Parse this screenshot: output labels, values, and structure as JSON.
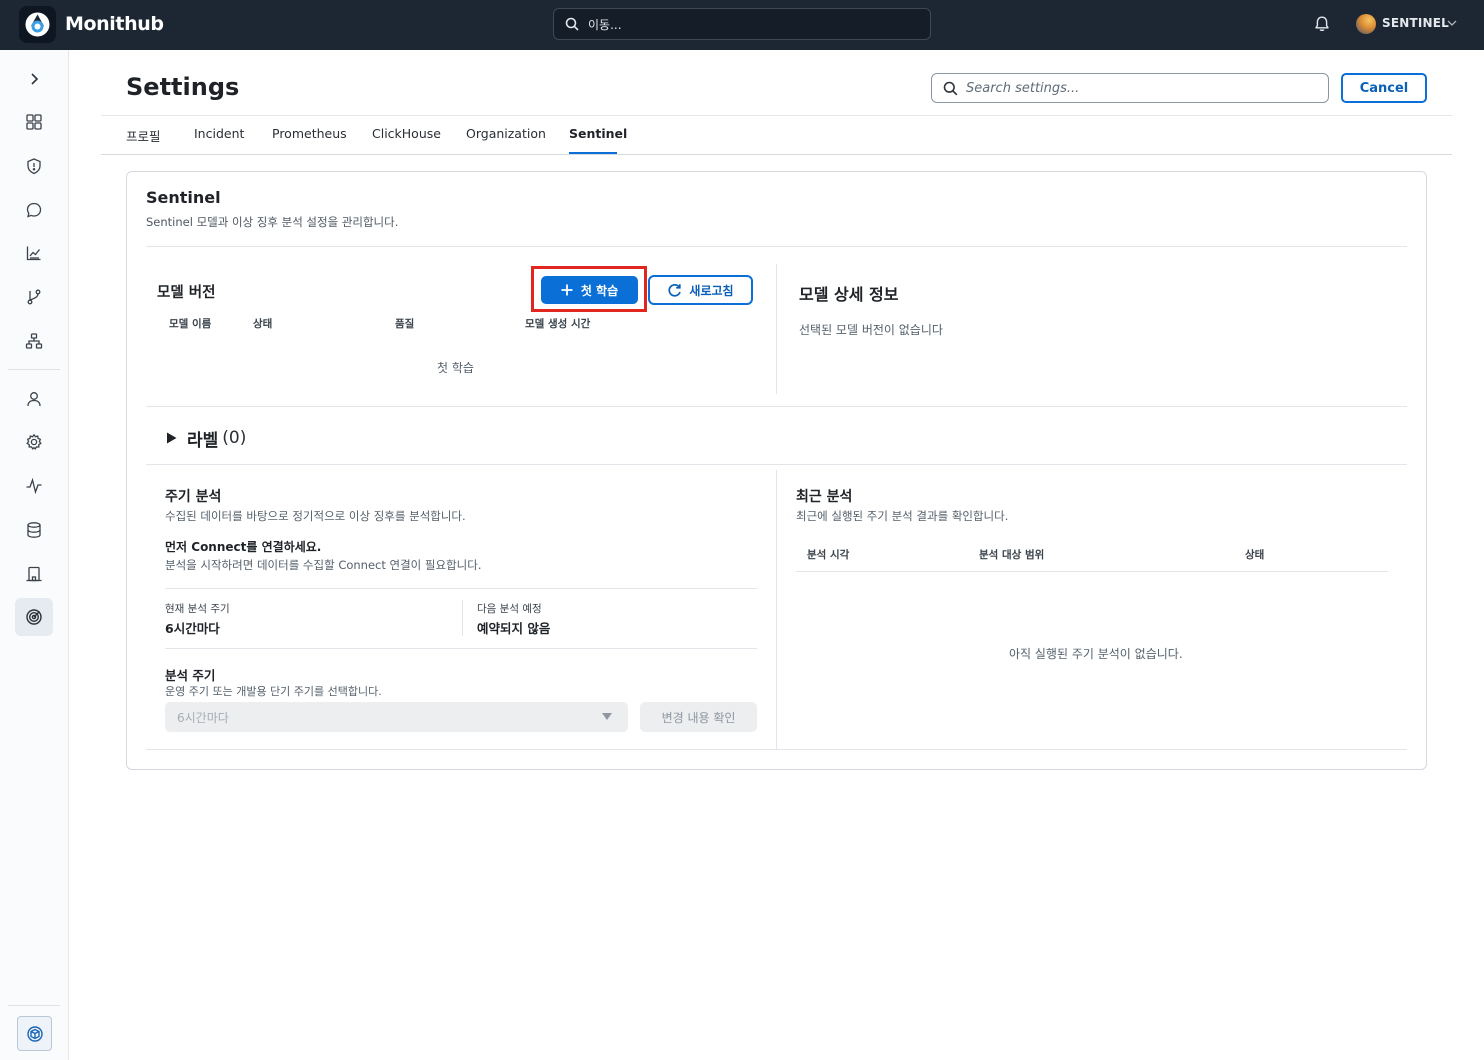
{
  "app": {
    "name": "Monithub"
  },
  "topbar": {
    "search_value": "이동...",
    "user_name": "SENTINEL"
  },
  "sidebar": {
    "items": [
      "chevron-right-icon",
      "dashboard-icon",
      "shield-icon",
      "chat-icon",
      "chart-icon",
      "git-branch-icon",
      "network-icon",
      "user-icon",
      "gear-icon",
      "activity-icon",
      "database-icon",
      "building-icon",
      "radar-icon"
    ],
    "active_item": "radar-icon",
    "bottom_item": "package-icon"
  },
  "header": {
    "title": "Settings",
    "search_placeholder": "Search settings...",
    "cancel_label": "Cancel"
  },
  "tabs": [
    {
      "label": "프로필",
      "active": false
    },
    {
      "label": "Incident",
      "active": false
    },
    {
      "label": "Prometheus",
      "active": false
    },
    {
      "label": "ClickHouse",
      "active": false
    },
    {
      "label": "Organization",
      "active": false
    },
    {
      "label": "Sentinel",
      "active": true
    }
  ],
  "section": {
    "title": "Sentinel",
    "description": "Sentinel 모델과 이상 징후 분석 설정을 관리합니다."
  },
  "model_versions": {
    "title": "모델 버전",
    "first_train_button": "첫 학습",
    "refresh_button": "새로고침",
    "columns": [
      "모델 이름",
      "상태",
      "품질",
      "모델 생성 시간"
    ],
    "empty_text": "첫 학습"
  },
  "model_detail": {
    "title": "모델 상세 정보",
    "empty_text": "선택된 모델 버전이 없습니다"
  },
  "labels": {
    "title": "라벨",
    "count": "(0)"
  },
  "periodic": {
    "title": "주기 분석",
    "description": "수집된 데이터를 바탕으로 정기적으로 이상 징후를 분석합니다.",
    "notice_title": "먼저 Connect를 연결하세요.",
    "notice_desc": "분석을 시작하려면 데이터를 수집할 Connect 연결이 필요합니다.",
    "current_label": "현재 분석 주기",
    "current_value": "6시간마다",
    "next_label": "다음 분석 예정",
    "next_value": "예약되지 않음",
    "interval_title": "분석 주기",
    "interval_desc": "운영 주기 또는 개발용 단기 주기를 선택합니다.",
    "select_value": "6시간마다",
    "confirm_button": "변경 내용 확인"
  },
  "recent": {
    "title": "최근 분석",
    "description": "최근에 실행된 주기 분석 결과를 확인합니다.",
    "columns": [
      "분석 시각",
      "분석 대상 범위",
      "상태"
    ],
    "empty_text": "아직 실행된 주기 분석이 없습니다."
  },
  "colors": {
    "topbar": "#1c2733",
    "accent": "#0a6fd6",
    "highlight": "#e0261f"
  }
}
